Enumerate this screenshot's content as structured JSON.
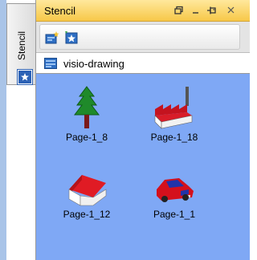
{
  "vertical_tab": {
    "label": "Stencil",
    "icon": "stencil-star-icon"
  },
  "panel": {
    "title": "Stencil",
    "title_icons": [
      "window-restore-icon",
      "minimize-icon",
      "pin-icon",
      "close-icon"
    ],
    "toolbar_icons": [
      "new-stencil-icon",
      "open-stencil-icon"
    ],
    "document": {
      "label": "visio-drawing",
      "icon": "document-icon"
    }
  },
  "shapes": [
    {
      "label": "Page-1_8",
      "icon": "tree-icon"
    },
    {
      "label": "Page-1_18",
      "icon": "factory-icon"
    },
    {
      "label": "Page-1_12",
      "icon": "house-icon"
    },
    {
      "label": "Page-1_1",
      "icon": "car-icon"
    }
  ],
  "colors": {
    "title_bar": "#f7c848",
    "canvas": "#7fa8f5",
    "side_strip": "#a9c4e8"
  }
}
